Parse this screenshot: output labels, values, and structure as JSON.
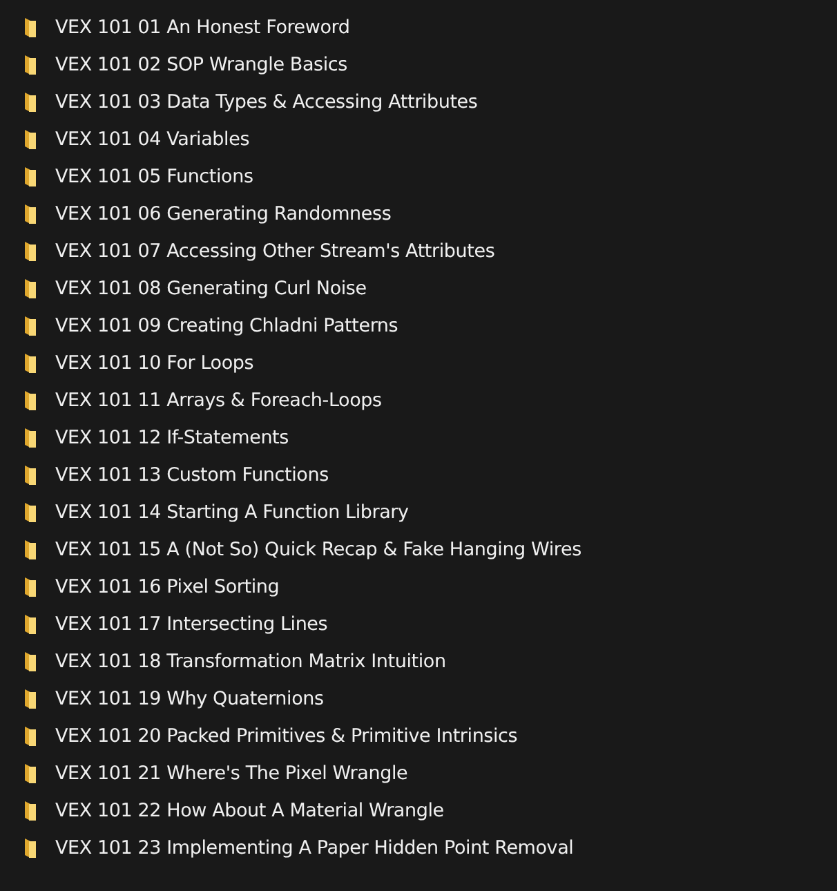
{
  "folders": [
    {
      "name": "VEX 101 01 An Honest Foreword"
    },
    {
      "name": "VEX 101 02 SOP Wrangle Basics"
    },
    {
      "name": "VEX 101 03 Data Types & Accessing Attributes"
    },
    {
      "name": "VEX 101 04 Variables"
    },
    {
      "name": "VEX 101 05 Functions"
    },
    {
      "name": "VEX 101 06 Generating Randomness"
    },
    {
      "name": "VEX 101 07 Accessing Other Stream's Attributes"
    },
    {
      "name": "VEX 101 08 Generating Curl Noise"
    },
    {
      "name": "VEX 101 09 Creating Chladni Patterns"
    },
    {
      "name": "VEX 101 10 For Loops"
    },
    {
      "name": "VEX 101 11 Arrays & Foreach-Loops"
    },
    {
      "name": "VEX 101 12 If-Statements"
    },
    {
      "name": "VEX 101 13 Custom Functions"
    },
    {
      "name": "VEX 101 14 Starting A Function Library"
    },
    {
      "name": "VEX 101 15 A (Not So) Quick Recap & Fake Hanging Wires"
    },
    {
      "name": "VEX 101 16 Pixel Sorting"
    },
    {
      "name": "VEX 101 17 Intersecting Lines"
    },
    {
      "name": "VEX 101 18 Transformation Matrix Intuition"
    },
    {
      "name": "VEX 101 19 Why Quaternions"
    },
    {
      "name": "VEX 101 20 Packed Primitives & Primitive Intrinsics"
    },
    {
      "name": "VEX 101 21 Where's The Pixel Wrangle"
    },
    {
      "name": "VEX 101 22 How About A Material Wrangle"
    },
    {
      "name": "VEX 101 23 Implementing A Paper Hidden Point Removal"
    }
  ]
}
